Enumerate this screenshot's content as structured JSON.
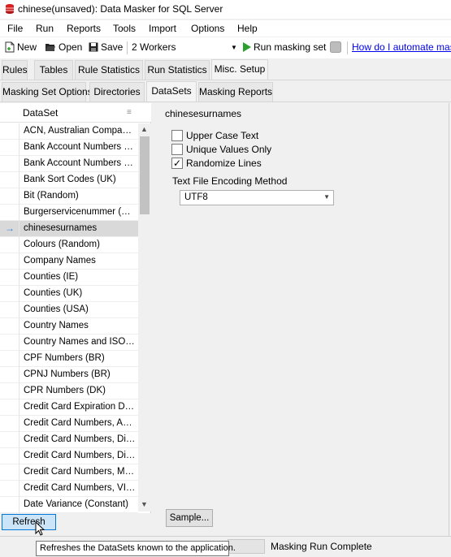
{
  "window": {
    "title": "chinese(unsaved): Data Masker for SQL Server"
  },
  "menu": [
    "File",
    "Run",
    "Reports",
    "Tools",
    "Import",
    "Options",
    "Help"
  ],
  "toolbar": {
    "new_label": "New",
    "open_label": "Open",
    "save_label": "Save",
    "workers_value": "2 Workers",
    "run_label": "Run masking set",
    "help_link": "How do I automate mas"
  },
  "main_tabs": [
    "Rules",
    "Tables",
    "Rule Statistics",
    "Run Statistics",
    "Misc. Setup"
  ],
  "sub_tabs": [
    "Masking Set Options",
    "Directories",
    "DataSets",
    "Masking Reports"
  ],
  "dataset_list": {
    "header": "DataSet",
    "items": [
      "ACN, Australian Company ...",
      "Bank Account Numbers (NL)",
      "Bank Account Numbers (NZ)",
      "Bank Sort Codes (UK)",
      "Bit (Random)",
      "Burgerservicenummer (NL)",
      "chinesesurnames",
      "Colours (Random)",
      "Company Names",
      "Counties (IE)",
      "Counties (UK)",
      "Counties (USA)",
      "Country Names",
      "Country Names and ISO Co...",
      "CPF Numbers (BR)",
      "CPNJ Numbers (BR)",
      "CPR Numbers (DK)",
      "Credit Card Expiration Dates",
      "Credit Card Numbers, AMEX",
      "Credit Card Numbers, Diners",
      "Credit Card Numbers, Disco...",
      "Credit Card Numbers, Mast...",
      "Credit Card Numbers, VISA",
      "Date Variance (Constant)"
    ],
    "selected_index": 6
  },
  "details": {
    "name": "chinesesurnames",
    "upper_case_label": "Upper Case Text",
    "unique_values_label": "Unique Values Only",
    "randomize_label": "Randomize Lines",
    "randomize_checked": true,
    "encoding_label": "Text File Encoding Method",
    "encoding_value": "UTF8",
    "sample_button": "Sample..."
  },
  "refresh_button": "Refresh",
  "tooltip": "Refreshes the DataSets known to the application.",
  "status": {
    "text": "Masking Run Complete"
  },
  "colors": {
    "accent": "#0078d7",
    "link": "#0000ee",
    "run_green": "#2ca02c",
    "icon_red": "#d81e1e"
  }
}
